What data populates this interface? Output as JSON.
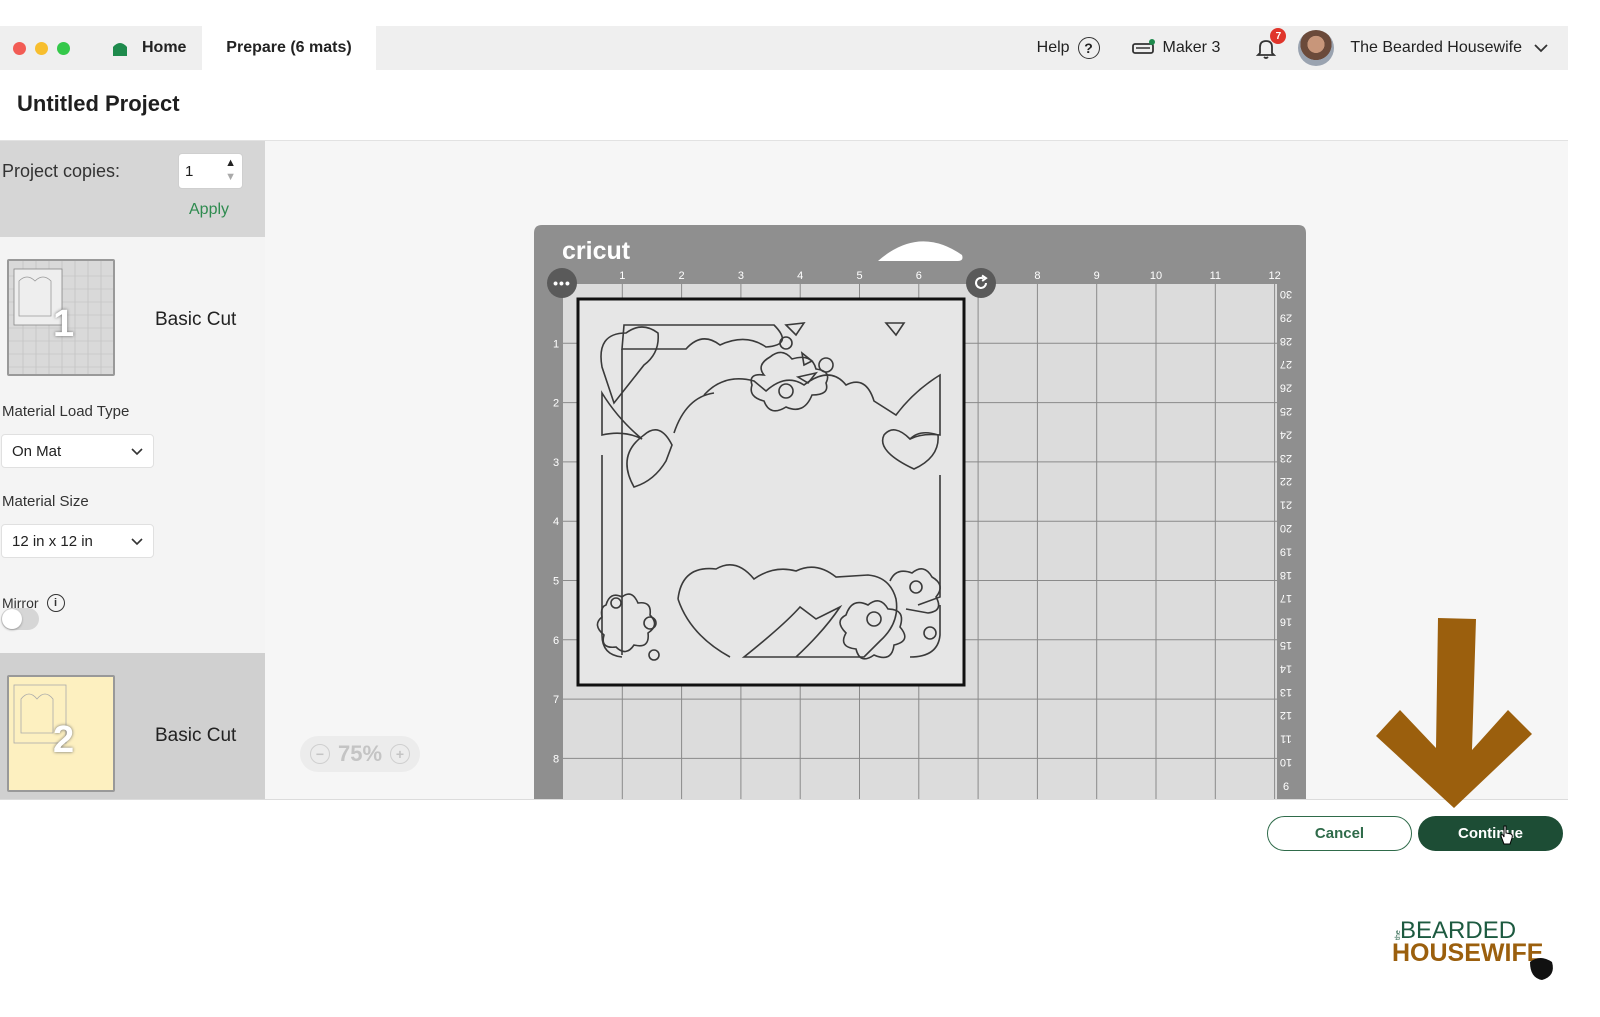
{
  "window": {
    "tabs": {
      "home": "Home",
      "prepare": "Prepare (6 mats)"
    },
    "help": "Help",
    "machine": "Maker 3",
    "notification_count": "7",
    "user_name": "The Bearded Housewife"
  },
  "project": {
    "title": "Untitled Project"
  },
  "sidebar": {
    "copies_label": "Project copies:",
    "copies_value": "1",
    "apply_label": "Apply",
    "mats": [
      {
        "number": "1",
        "label": "Basic Cut"
      },
      {
        "number": "2",
        "label": "Basic Cut"
      }
    ],
    "material_load_type_label": "Material Load Type",
    "material_load_type_value": "On Mat",
    "material_size_label": "Material Size",
    "material_size_value": "12 in x 12 in",
    "mirror_label": "Mirror",
    "mirror_on": false
  },
  "canvas": {
    "brand": "cricut",
    "zoom": "75%",
    "top_ruler": [
      "1",
      "2",
      "3",
      "4",
      "5",
      "6",
      "7",
      "8",
      "9",
      "10",
      "11",
      "12"
    ],
    "left_ruler": [
      "1",
      "2",
      "3",
      "4",
      "5",
      "6",
      "7",
      "8"
    ],
    "right_ruler": [
      "30",
      "29",
      "28",
      "27",
      "26",
      "25",
      "24",
      "23",
      "22",
      "21",
      "20",
      "19",
      "18",
      "17",
      "16",
      "15",
      "14",
      "13",
      "12",
      "11",
      "10",
      "9"
    ]
  },
  "footer": {
    "cancel": "Cancel",
    "continue": "Continue"
  },
  "watermark": {
    "small": "the",
    "line1": "BEARDED",
    "line2": "HOUSEWIFE"
  },
  "colors": {
    "brand_green": "#1d4d35",
    "accent_green": "#2e8b4f",
    "mat_gray": "#8f8f8f",
    "arrow": "#9b5f0d",
    "notification": "#e0352b"
  }
}
